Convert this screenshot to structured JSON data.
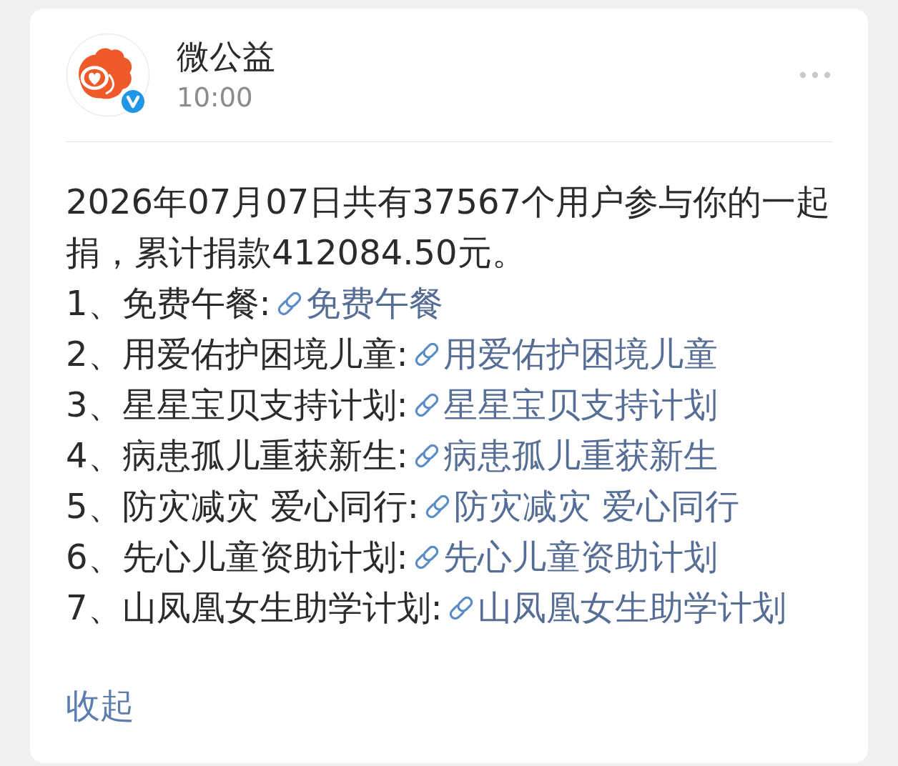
{
  "card": {
    "author": {
      "name": "微公益",
      "verified": true
    },
    "time": "10:00",
    "summary": "2026年07月07日共有37567个用户参与你的一起捐，累计捐款412084.50元。",
    "items": [
      {
        "label": "1、免费午餐:",
        "link": "免费午餐"
      },
      {
        "label": "2、用爱佑护困境儿童:",
        "link": "用爱佑护困境儿童"
      },
      {
        "label": "3、星星宝贝支持计划:",
        "link": "星星宝贝支持计划"
      },
      {
        "label": "4、病患孤儿重获新生:",
        "link": "病患孤儿重获新生"
      },
      {
        "label": "5、防灾减灾 爱心同行:",
        "link": "防灾减灾 爱心同行"
      },
      {
        "label": "6、先心儿童资助计划:",
        "link": "先心儿童资助计划"
      },
      {
        "label": "7、山凤凰女生助学计划:",
        "link": "山凤凰女生助学计划"
      }
    ],
    "collapse_link": "收起"
  }
}
